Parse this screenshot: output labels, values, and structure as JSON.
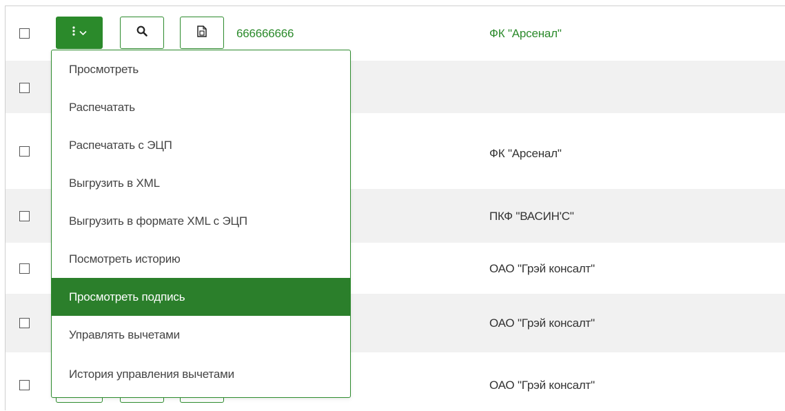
{
  "colors": {
    "accent": "#2b8a2b",
    "menu_active": "#2b7f2b",
    "row_alt": "#f1f1f1"
  },
  "first_row": {
    "number": "666666666",
    "organization": "ФК \"Арсенал\""
  },
  "actions_button": {
    "icon": "vertical-dots-icon",
    "chevron": "chevron-down-icon"
  },
  "search_button": {
    "icon": "search-icon"
  },
  "doc_button": {
    "icon": "document-icon"
  },
  "rows": [
    {
      "organization": ""
    },
    {
      "organization": ""
    },
    {
      "organization": "ФК \"Арсенал\""
    },
    {
      "organization": ""
    },
    {
      "organization": "ПКФ \"ВАСИН'С\""
    },
    {
      "organization": "ОАО \"Грэй консалт\""
    },
    {
      "organization": "ОАО \"Грэй консалт\""
    },
    {
      "organization": "ОАО \"Грэй консалт\""
    }
  ],
  "menu": {
    "items": [
      "Просмотреть",
      "Распечатать",
      "Распечатать с ЭЦП",
      "Выгрузить в XML",
      "Выгрузить в формате XML с ЭЦП",
      "Посмотреть историю",
      "Просмотреть подпись",
      "Управлять вычетами",
      "История управления вычетами"
    ],
    "active_item": "Просмотреть подпись"
  }
}
